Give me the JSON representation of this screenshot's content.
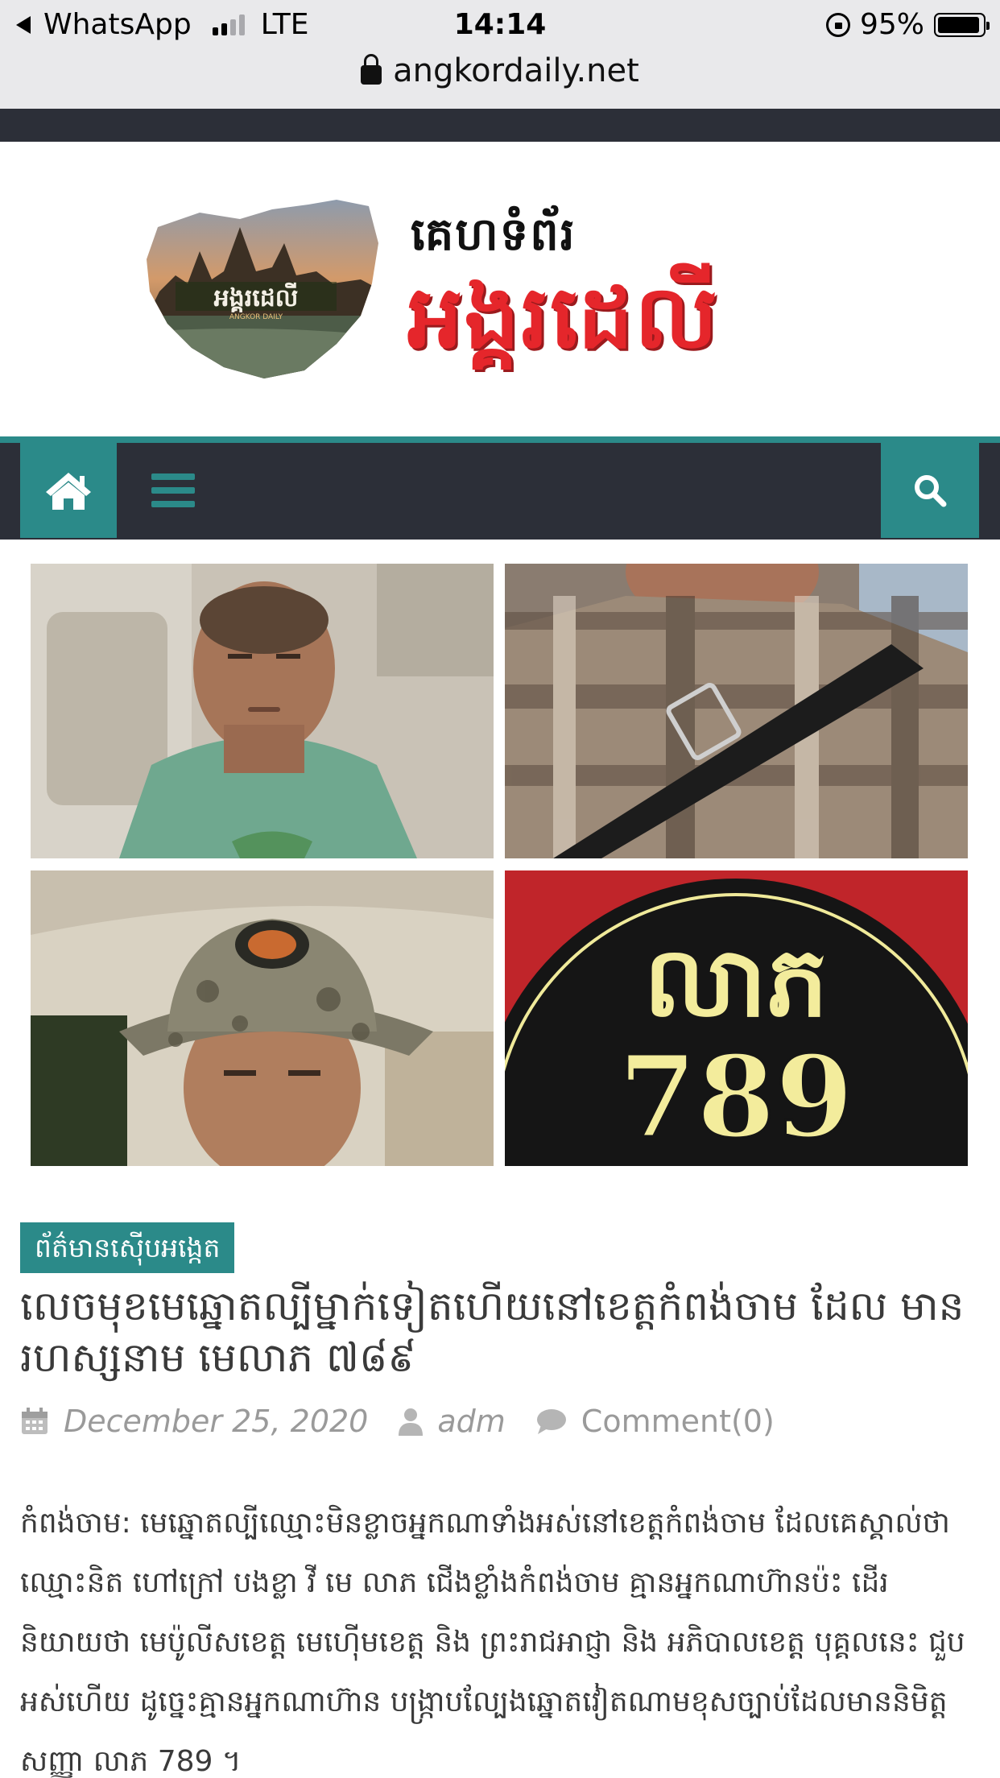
{
  "status_bar": {
    "back_app": "WhatsApp",
    "network": "LTE",
    "time": "14:14",
    "battery": "95%"
  },
  "browser": {
    "url": "angkordaily.net"
  },
  "site": {
    "logo_subtitle": "គេហទំព័រ",
    "logo_title": "អង្គរដេលី",
    "map_badge": "អង្គរដេលី",
    "map_badge_latin": "ANGKOR DAILY",
    "brand_color": "#2b8a89",
    "nav_dark": "#2c2f38",
    "logo_red": "#e5262b"
  },
  "nav": {
    "home_icon": "home-icon",
    "menu_icon": "hamburger-menu-icon",
    "search_icon": "search-icon"
  },
  "images": {
    "badge_text": "លាភ",
    "badge_number": "789"
  },
  "article": {
    "category": "ព័ត៌មានស៊ើបអង្កេត",
    "title": "លេចមុខមេឆ្នោតល្បីម្នាក់ទៀតហើយនៅខេត្តកំពង់ចាម ដែល មានរហស្សនាម មេលាភ ៧៨៩",
    "date": "December 25, 2020",
    "author": "adm",
    "comments": "Comment(0)",
    "body": "កំពង់ចាម: មេឆ្នោតល្បីឈ្មោះមិនខ្លាចអ្នកណាទាំងអស់នៅខេត្តកំពង់ចាម ដែលគេស្គាល់ថា ឈ្មោះនិត ហៅក្រៅ បងខ្លា វី មេ លាភ ជើងខ្លាំងកំពង់ចាម គ្មានអ្នកណាហ៊ានប៉ះ ដើរនិយាយថា មេប៉ូលីសខេត្ត មេហ៊ើមខេត្ត និង ព្រះរាជអាជ្ញា និង អភិបាលខេត្ត បុគ្គលនេះ ជួបអស់ហើយ ដូច្នេះគ្មានអ្នកណាហ៊ាន បង្ក្រាបល្បែងឆ្នោតវៀតណាមខុសច្បាប់ដែលមាននិមិត្តសញ្ញា លាភ 789 ។"
  }
}
